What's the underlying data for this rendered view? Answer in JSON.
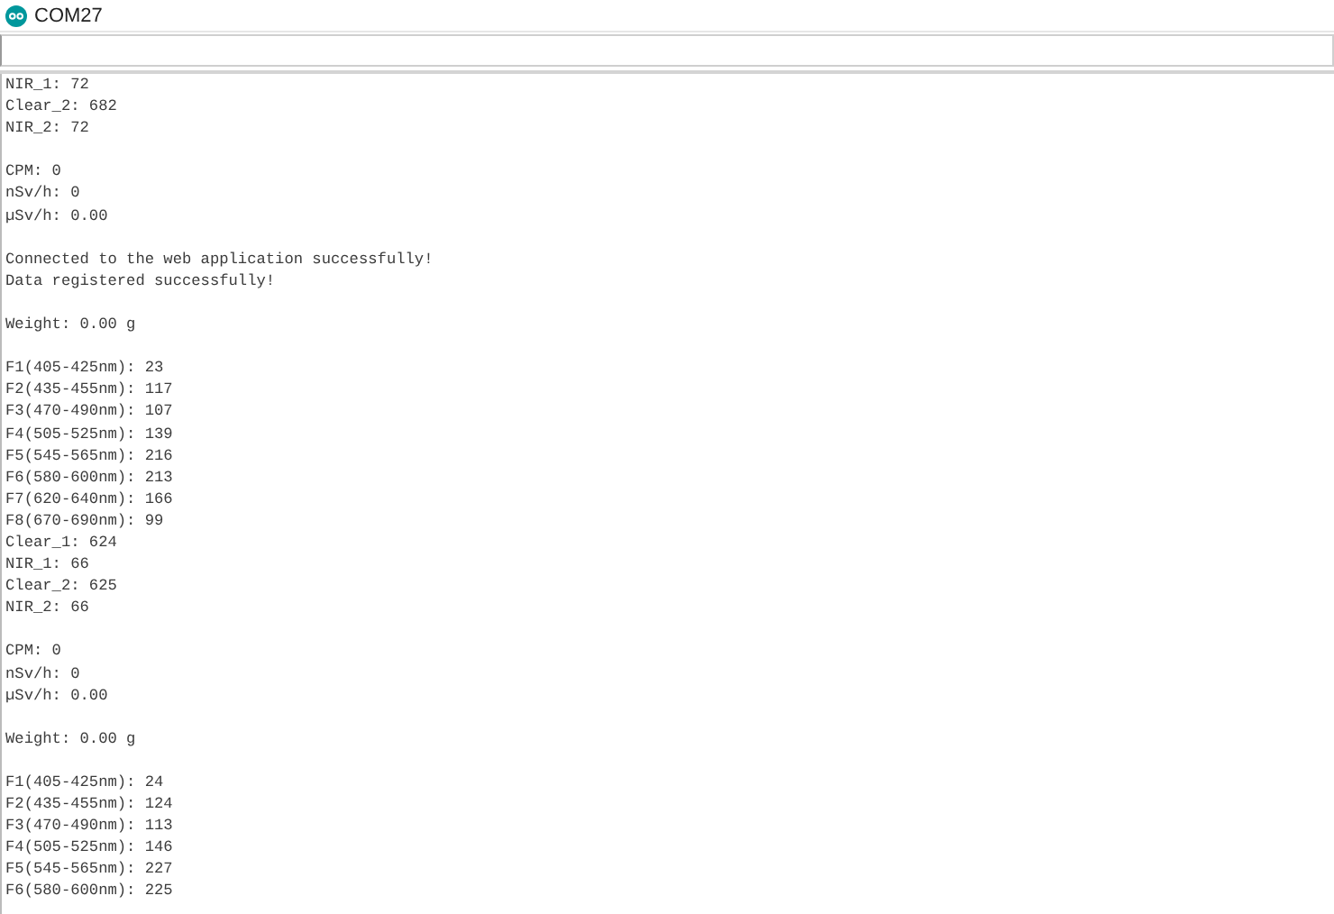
{
  "window": {
    "title": "COM27"
  },
  "input": {
    "kind": "text-entry"
  },
  "output": [
    {
      "kind": "text",
      "text": "NIR_1: 72"
    },
    {
      "kind": "text",
      "text": "Clear_2: 682"
    },
    {
      "kind": "text",
      "text": "NIR_2: 72"
    },
    {
      "kind": "blank"
    },
    {
      "kind": "text",
      "text": "CPM: 0"
    },
    {
      "kind": "text",
      "text": "nSv/h: 0"
    },
    {
      "kind": "text",
      "text": "µSv/h: 0.00"
    },
    {
      "kind": "blank"
    },
    {
      "kind": "text",
      "text": "Connected to the web application successfully!"
    },
    {
      "kind": "text",
      "text": "Data registered successfully!"
    },
    {
      "kind": "blank"
    },
    {
      "kind": "text",
      "text": "Weight: 0.00 g"
    },
    {
      "kind": "blank"
    },
    {
      "kind": "text",
      "text": "F1(405-425nm): 23"
    },
    {
      "kind": "text",
      "text": "F2(435-455nm): 117"
    },
    {
      "kind": "text",
      "text": "F3(470-490nm): 107"
    },
    {
      "kind": "text",
      "text": "F4(505-525nm): 139"
    },
    {
      "kind": "text",
      "text": "F5(545-565nm): 216"
    },
    {
      "kind": "text",
      "text": "F6(580-600nm): 213"
    },
    {
      "kind": "text",
      "text": "F7(620-640nm): 166"
    },
    {
      "kind": "text",
      "text": "F8(670-690nm): 99"
    },
    {
      "kind": "text",
      "text": "Clear_1: 624"
    },
    {
      "kind": "text",
      "text": "NIR_1: 66"
    },
    {
      "kind": "text",
      "text": "Clear_2: 625"
    },
    {
      "kind": "text",
      "text": "NIR_2: 66"
    },
    {
      "kind": "blank"
    },
    {
      "kind": "text",
      "text": "CPM: 0"
    },
    {
      "kind": "text",
      "text": "nSv/h: 0"
    },
    {
      "kind": "text",
      "text": "µSv/h: 0.00"
    },
    {
      "kind": "blank"
    },
    {
      "kind": "text",
      "text": "Weight: 0.00 g"
    },
    {
      "kind": "blank"
    },
    {
      "kind": "text",
      "text": "F1(405-425nm): 24"
    },
    {
      "kind": "text",
      "text": "F2(435-455nm): 124"
    },
    {
      "kind": "text",
      "text": "F3(470-490nm): 113"
    },
    {
      "kind": "text",
      "text": "F4(505-525nm): 146"
    },
    {
      "kind": "text",
      "text": "F5(545-565nm): 227"
    },
    {
      "kind": "text",
      "text": "F6(580-600nm): 225"
    }
  ]
}
